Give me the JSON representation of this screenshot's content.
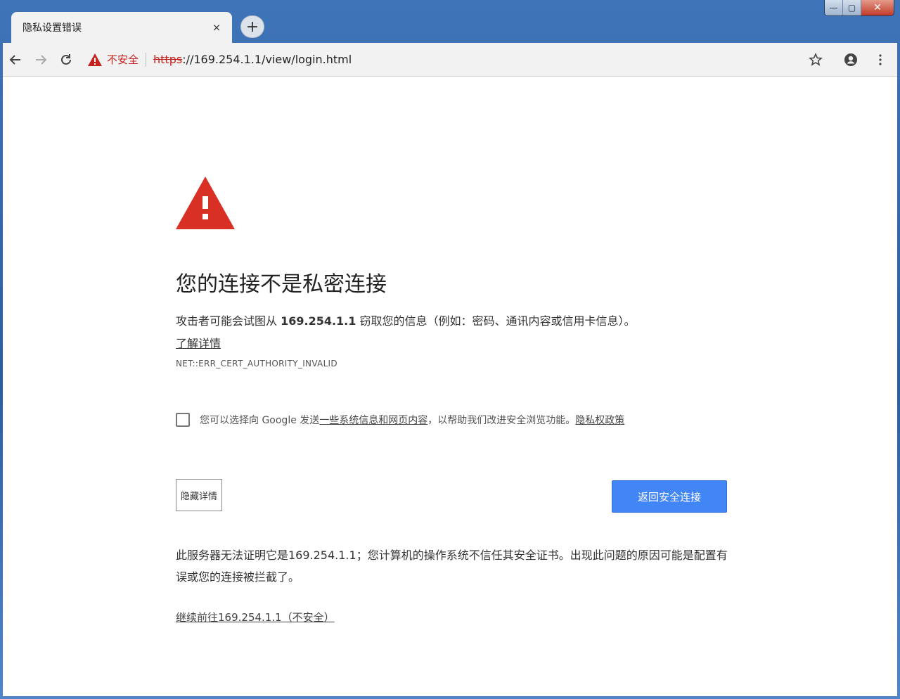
{
  "window": {
    "minimize_glyph": "—",
    "maximize_glyph": "▢",
    "close_glyph": "✕"
  },
  "tab": {
    "title": "隐私设置错误",
    "close_glyph": "×"
  },
  "new_tab_glyph": "+",
  "toolbar": {
    "icons": [
      "back-arrow-icon",
      "forward-arrow-icon",
      "reload-icon",
      "warning-icon",
      "star-icon",
      "account-icon",
      "more-vert-icon"
    ],
    "security_label": "不安全",
    "url_scheme": "https",
    "url_rest": "://169.254.1.1/view/login.html"
  },
  "page": {
    "heading": "您的连接不是私密连接",
    "explain_prefix": "攻击者可能会试图从 ",
    "explain_host": "169.254.1.1",
    "explain_suffix": " 窃取您的信息（例如：密码、通讯内容或信用卡信息）。",
    "learn_more": "了解详情",
    "error_code": "NET::ERR_CERT_AUTHORITY_INVALID",
    "optin_prefix": "您可以选择向 Google 发送",
    "optin_link": "一些系统信息和网页内容",
    "optin_middle": "，以帮助我们改进安全浏览功能。",
    "optin_privacy_link": "隐私权政策",
    "details_button": "隐藏详情",
    "primary_button": "返回安全连接",
    "details_text": "此服务器无法证明它是169.254.1.1；您计算机的操作系统不信任其安全证书。出现此问题的原因可能是配置有误或您的连接被拦截了。",
    "proceed_link": "继续前往169.254.1.1（不安全）"
  },
  "colors": {
    "danger_red": "#c5221f",
    "warning_triangle": "#d93025",
    "primary_blue": "#4285f4",
    "chrome_bg": "#f2f2f2",
    "titlebar_blue": "#2a5f9f"
  }
}
